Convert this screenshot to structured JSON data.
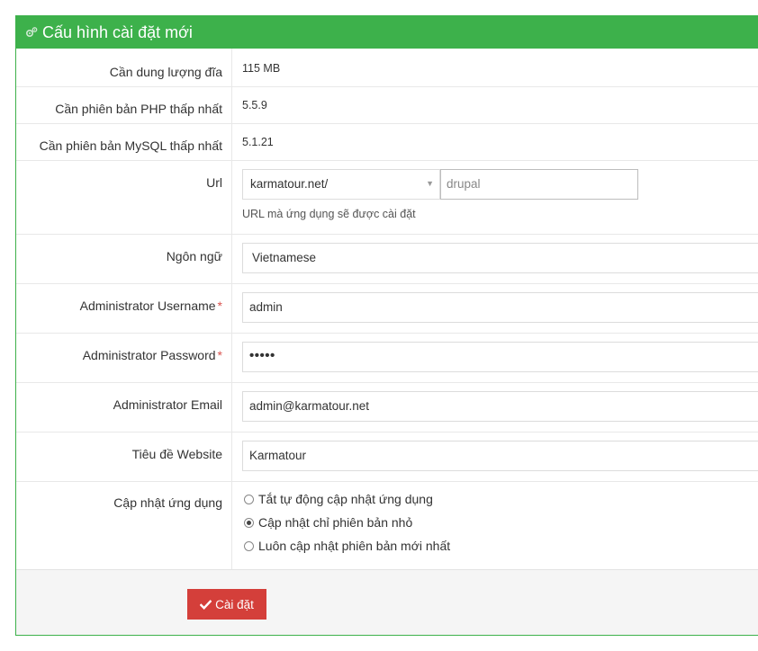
{
  "panel": {
    "title": "Cấu hình cài đặt mới",
    "header_color": "#3db14b"
  },
  "requirements": {
    "disk": {
      "label": "Cần dung lượng đĩa",
      "value": "115 MB"
    },
    "php": {
      "label": "Cần phiên bản PHP thấp nhất",
      "value": "5.5.9"
    },
    "mysql": {
      "label": "Cần phiên bản MySQL thấp nhất",
      "value": "5.1.21"
    }
  },
  "form": {
    "url": {
      "label": "Url",
      "domain_selected": "karmatour.net/",
      "path_placeholder": "drupal",
      "help": "URL mà ứng dụng sẽ được cài đặt"
    },
    "language": {
      "label": "Ngôn ngữ",
      "value": "Vietnamese"
    },
    "admin_username": {
      "label": "Administrator Username",
      "required_mark": "*",
      "value": "admin"
    },
    "admin_password": {
      "label": "Administrator Password",
      "required_mark": "*",
      "masked_value": "•••••"
    },
    "admin_email": {
      "label": "Administrator Email",
      "value": "admin@karmatour.net"
    },
    "site_title": {
      "label": "Tiêu đề Website",
      "value": "Karmatour"
    },
    "updates": {
      "label": "Cập nhật ứng dụng",
      "options": [
        {
          "label": "Tắt tự động cập nhật ứng dụng",
          "checked": false
        },
        {
          "label": "Cập nhật chỉ phiên bản nhỏ",
          "checked": true
        },
        {
          "label": "Luôn cập nhật phiên bản mới nhất",
          "checked": false
        }
      ]
    }
  },
  "footer": {
    "install_label": "Cài đặt",
    "install_color": "#d43f3a"
  },
  "icons": {
    "header": "gears-icon",
    "install": "check-icon",
    "select": "caret-down-icon"
  }
}
